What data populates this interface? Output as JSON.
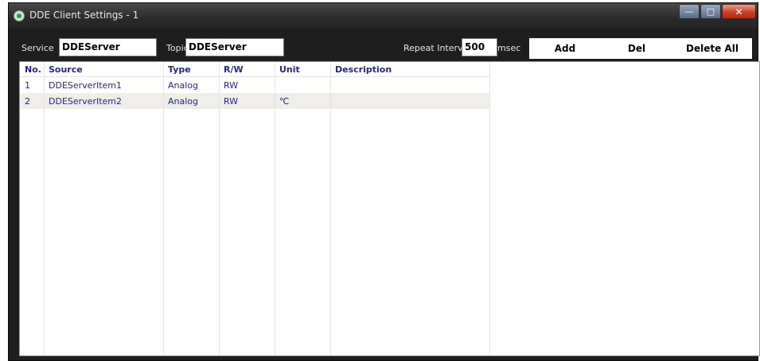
{
  "window": {
    "title": "DDE Client Settings - 1"
  },
  "toolbar": {
    "service_label": "Service",
    "service_value": "DDEServer",
    "topic_label": "Topic",
    "topic_value": "DDEServer",
    "repeat_label": "Repeat Interval",
    "repeat_value": "500",
    "repeat_unit": "msec",
    "add_label": "Add",
    "del_label": "Del",
    "delete_all_label": "Delete All"
  },
  "table": {
    "headers": [
      "No.",
      "Source",
      "Type",
      "R/W",
      "Unit",
      "Description"
    ],
    "rows": [
      [
        "1",
        "DDEServerItem1",
        "Analog",
        "RW",
        "",
        ""
      ],
      [
        "2",
        "DDEServerItem2",
        "Analog",
        "RW",
        "℃",
        ""
      ]
    ]
  },
  "icons": {
    "title_icon": "app-icon",
    "minimize": "minimize-icon",
    "maximize": "maximize-icon",
    "close": "close-icon"
  },
  "colors": {
    "header_text": "#1e2a8a",
    "selected_row": "#efeee8",
    "window_bg": "#1e1e1e"
  }
}
